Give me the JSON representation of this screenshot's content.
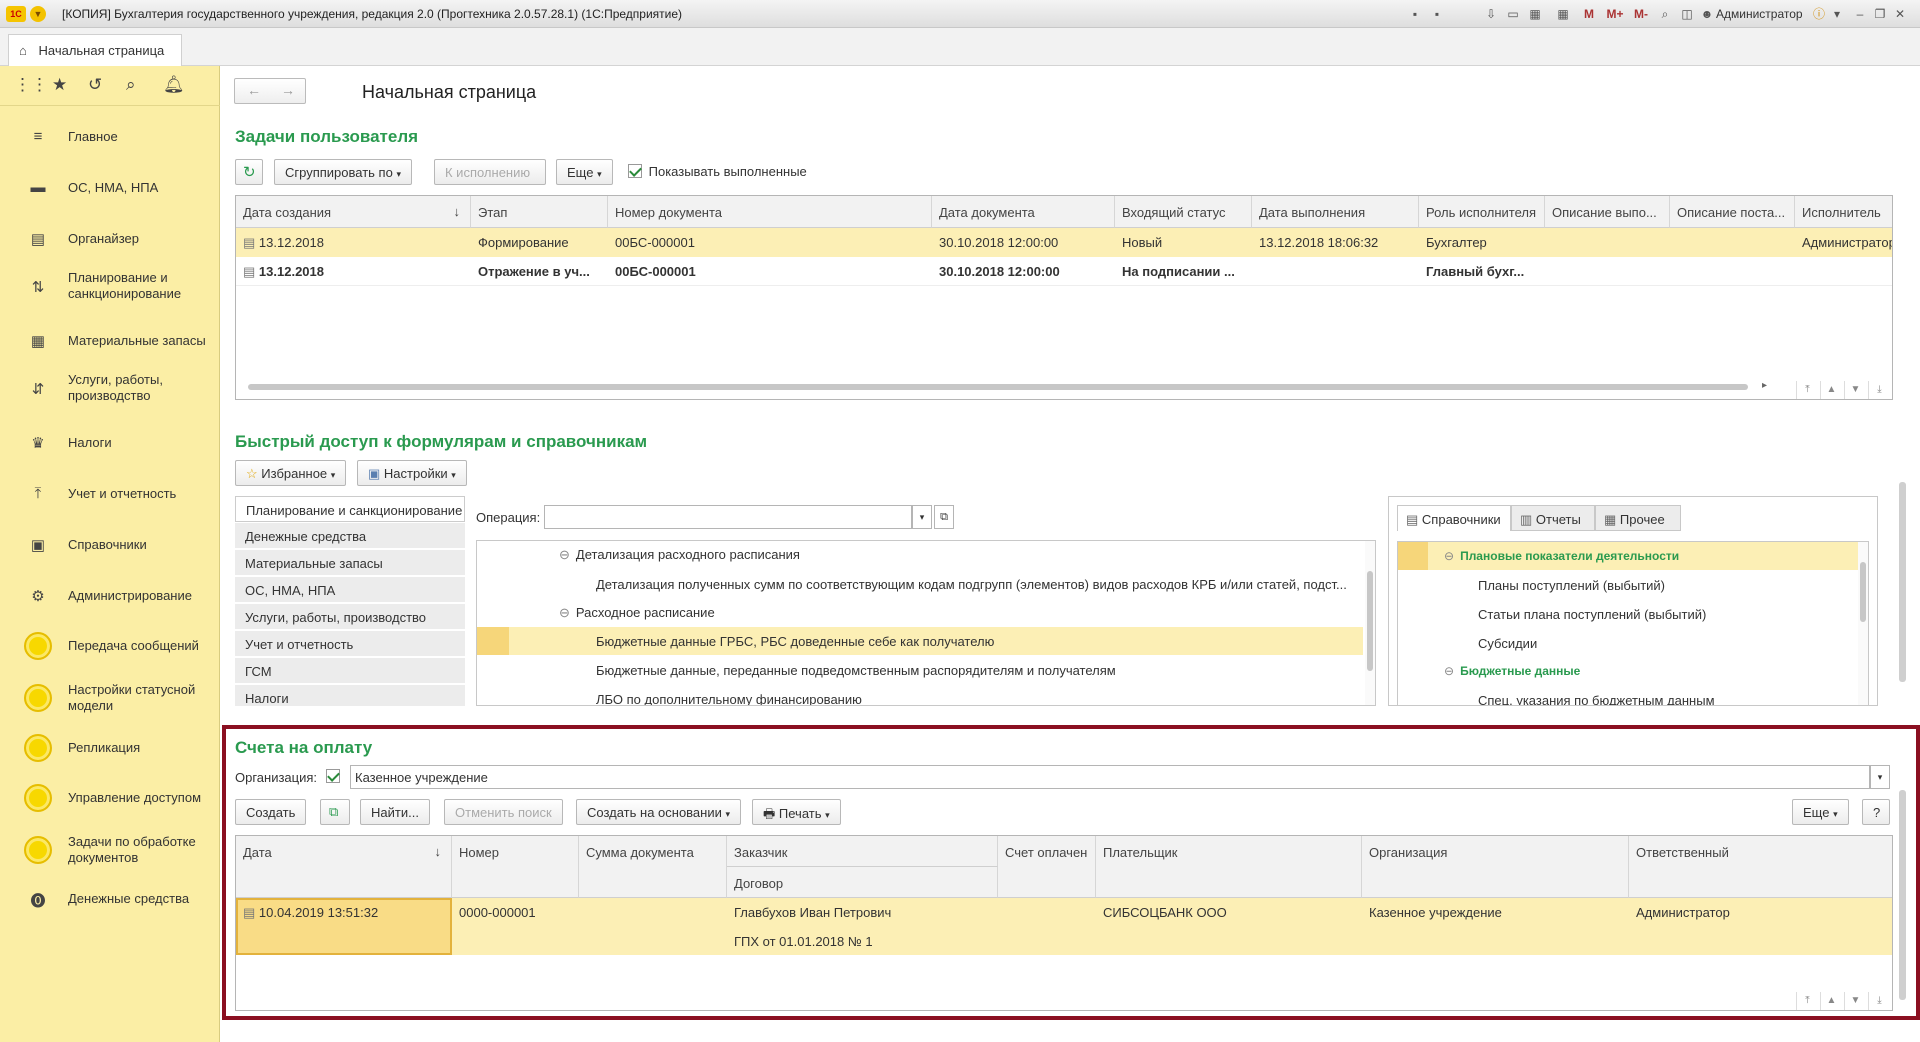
{
  "app": {
    "title": "[КОПИЯ] Бухгалтерия государственного учреждения, редакция 2.0 (Прогтехника 2.0.57.28.1)  (1С:Предприятие)",
    "user": "Администратор",
    "home_tab": "Начальная страница"
  },
  "sidebar": {
    "items": [
      {
        "label": "Главное",
        "icon": "menu-icon"
      },
      {
        "label": "ОС, НМА, НПА",
        "icon": "truck-icon"
      },
      {
        "label": "Органайзер",
        "icon": "organizer-icon"
      },
      {
        "label": "Планирование и санкционирование",
        "icon": "planning-icon"
      },
      {
        "label": "Материальные запасы",
        "icon": "grid-icon"
      },
      {
        "label": "Услуги, работы, производство",
        "icon": "services-icon"
      },
      {
        "label": "Налоги",
        "icon": "emblem-icon"
      },
      {
        "label": "Учет и отчетность",
        "icon": "chart-icon"
      },
      {
        "label": "Справочники",
        "icon": "book-icon"
      },
      {
        "label": "Администрирование",
        "icon": "gear-icon"
      },
      {
        "label": "Передача сообщений",
        "icon": "circle-icon"
      },
      {
        "label": "Настройки статусной модели",
        "icon": "circle-icon"
      },
      {
        "label": "Репликация",
        "icon": "circle-icon"
      },
      {
        "label": "Управление доступом",
        "icon": "circle-icon"
      },
      {
        "label": "Задачи по обработке документов",
        "icon": "circle-icon"
      },
      {
        "label": "Денежные средства",
        "icon": "coin-icon"
      }
    ]
  },
  "page": {
    "title": "Начальная страница"
  },
  "tasks": {
    "title": "Задачи пользователя",
    "group_btn": "Сгруппировать по",
    "exec_btn": "К исполнению",
    "more_btn": "Еще",
    "show_done": "Показывать выполненные",
    "columns": [
      "Дата создания",
      "Этап",
      "Номер документа",
      "Дата документа",
      "Входящий статус",
      "Дата выполнения",
      "Роль исполнителя",
      "Описание выпо...",
      "Описание поста...",
      "Исполнитель"
    ],
    "rows": [
      [
        "13.12.2018",
        "Формирование",
        "00БС-000001",
        "30.10.2018 12:00:00",
        "Новый",
        "13.12.2018 18:06:32",
        "Бухгалтер",
        "",
        "",
        "Администратор"
      ],
      [
        "13.12.2018",
        "Отражение в уч...",
        "00БС-000001",
        "30.10.2018 12:00:00",
        "На подписании ...",
        "",
        "Главный бухг...",
        "",
        "",
        " "
      ]
    ]
  },
  "quick": {
    "title": "Быстрый доступ к формулярам и справочникам",
    "fav_btn": "Избранное",
    "settings_btn": "Настройки",
    "operation_label": "Операция:",
    "operation_value": "",
    "sections": [
      "Планирование и санкционирование",
      "Денежные средства",
      "Материальные запасы",
      "ОС, НМА, НПА",
      "Услуги, работы, производство",
      "Учет и отчетность",
      "ГСМ",
      "Налоги"
    ],
    "tree": [
      "Детализация расходного расписания",
      "Детализация полученных сумм по соответствующим кодам подгрупп (элементов) видов расходов КРБ и/или статей, подст...",
      "Расходное расписание",
      "Бюджетные данные ГРБС, РБС доведенные себе как получателю",
      "Бюджетные данные, переданные подведомственным распорядителям и получателям",
      "ЛБО по дополнительному финансированию"
    ],
    "tabs": [
      "Справочники",
      "Отчеты",
      "Прочее"
    ],
    "right_tree": [
      "Плановые показатели деятельности",
      "Планы поступлений (выбытий)",
      "Статьи плана поступлений (выбытий)",
      "Субсидии",
      "Бюджетные данные",
      "Спец. указания по бюджетным данным"
    ]
  },
  "invoices": {
    "title": "Счета на оплату",
    "org_label": "Организация:",
    "org_value": "Казенное учреждение",
    "create_btn": "Создать",
    "find_btn": "Найти...",
    "cancel_btn": "Отменить поиск",
    "basis_btn": "Создать на основании",
    "print_btn": "Печать",
    "more_btn": "Еще",
    "help_btn": "?",
    "columns": [
      "Дата",
      "Номер",
      "Сумма документа",
      "Заказчик",
      "Договор",
      "Счет оплачен",
      "Плательщик",
      "Организация",
      "Ответственный"
    ],
    "row": {
      "date": "10.04.2019 13:51:32",
      "number": "0000-000001",
      "sum": "",
      "customer": "Главбухов Иван Петрович",
      "contract": "ГПХ от 01.01.2018 № 1",
      "paid": "",
      "payer": "СИБСОЦБАНК ООО",
      "org": "Казенное учреждение",
      "responsible": "Администратор"
    }
  },
  "colors": {
    "accent_green": "#2a9a4f",
    "sidebar_bg": "#fbeea5",
    "row_highlight": "#fcefb5",
    "frame": "#8b0f21"
  }
}
